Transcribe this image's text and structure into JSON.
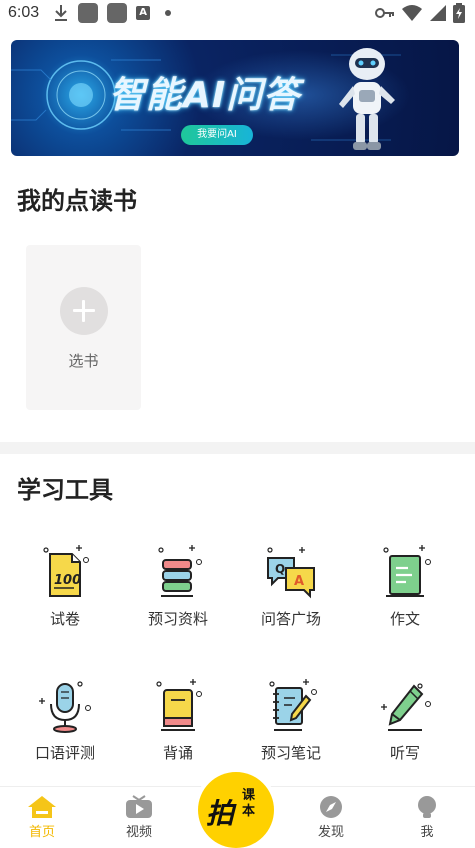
{
  "status_bar": {
    "time": "6:03",
    "icons": [
      "download-icon",
      "app-icon",
      "app-icon",
      "a-icon",
      "dot-icon",
      "key-icon",
      "wifi-icon",
      "signal-icon",
      "battery-icon"
    ]
  },
  "banner": {
    "title": "智能AI问答",
    "button_label": "我要问AI",
    "dots": 4,
    "active_dot": 2
  },
  "my_books": {
    "title": "我的点读书",
    "add_label": "选书"
  },
  "tools": {
    "title": "学习工具",
    "items": [
      {
        "label": "试卷",
        "icon": "exam-paper-icon"
      },
      {
        "label": "预习资料",
        "icon": "books-stack-icon"
      },
      {
        "label": "问答广场",
        "icon": "qa-bubbles-icon"
      },
      {
        "label": "作文",
        "icon": "notebook-icon"
      },
      {
        "label": "口语评测",
        "icon": "microphone-icon"
      },
      {
        "label": "背诵",
        "icon": "book-icon"
      },
      {
        "label": "预习笔记",
        "icon": "notes-pen-icon"
      },
      {
        "label": "听写",
        "icon": "pencil-icon"
      }
    ]
  },
  "bottom_nav": {
    "items": [
      {
        "label": "首页",
        "icon": "home-icon",
        "active": true
      },
      {
        "label": "视频",
        "icon": "tv-icon",
        "active": false
      },
      {
        "label": "发现",
        "icon": "compass-icon",
        "active": false
      },
      {
        "label": "我",
        "icon": "user-icon",
        "active": false
      }
    ],
    "camera": {
      "main": "拍",
      "side": "课本"
    }
  },
  "colors": {
    "accent": "#ffd100",
    "active_nav": "#f3b800"
  }
}
